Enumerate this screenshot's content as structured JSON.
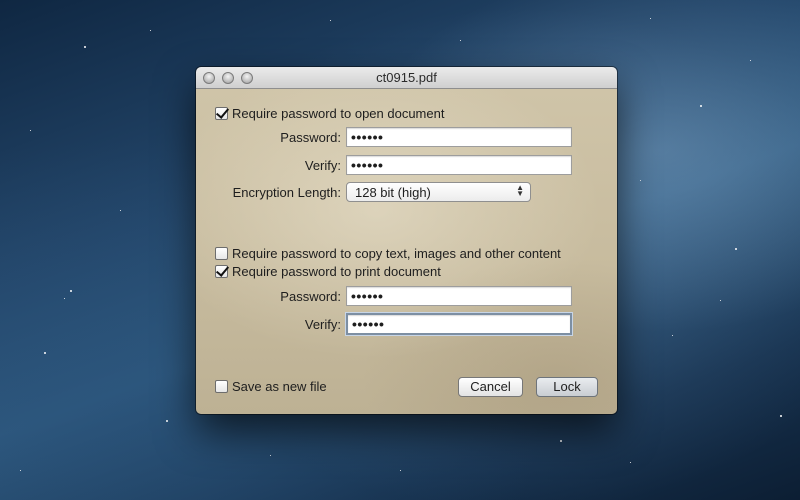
{
  "window": {
    "title": "ct0915.pdf"
  },
  "open_section": {
    "require_label": "Require password to open document",
    "require_checked": true,
    "password_label": "Password:",
    "password_value": "••••••",
    "verify_label": "Verify:",
    "verify_value": "••••••",
    "encryption_label": "Encryption Length:",
    "encryption_value": "128 bit (high)"
  },
  "copy_section": {
    "require_label": "Require password to copy text, images and other content",
    "require_checked": false
  },
  "print_section": {
    "require_label": "Require password to print document",
    "require_checked": true,
    "password_label": "Password:",
    "password_value": "••••••",
    "verify_label": "Verify:",
    "verify_value": "••••••"
  },
  "footer": {
    "save_new_label": "Save as new file",
    "save_new_checked": false,
    "cancel_label": "Cancel",
    "lock_label": "Lock"
  }
}
